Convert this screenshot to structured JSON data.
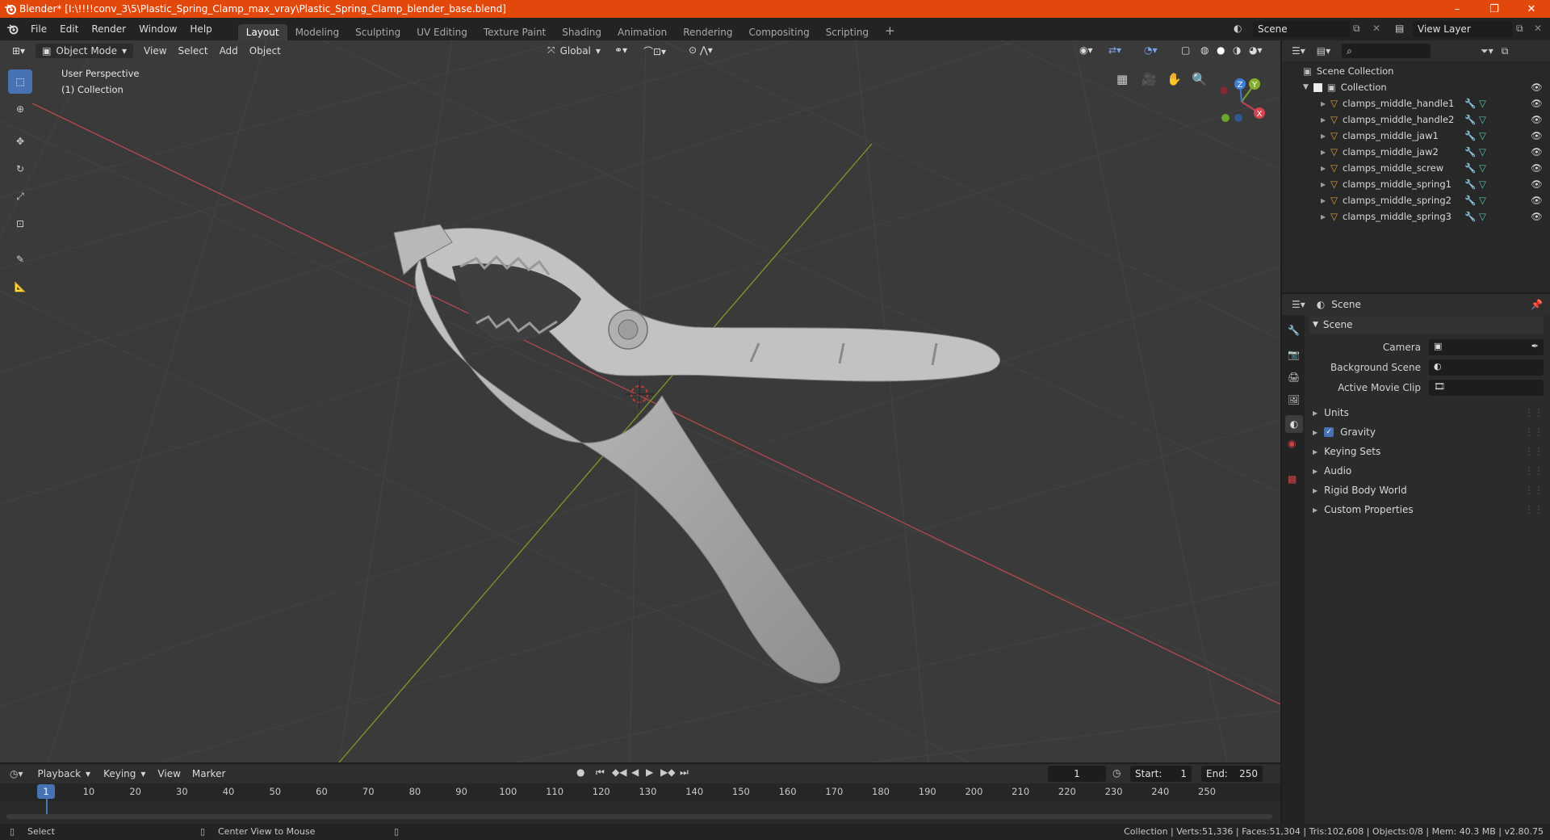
{
  "window": {
    "title": "Blender* [I:\\!!!!conv_3\\5\\Plastic_Spring_Clamp_max_vray\\Plastic_Spring_Clamp_blender_base.blend]",
    "controls": [
      "–",
      "❐",
      "✕"
    ]
  },
  "menu": [
    "File",
    "Edit",
    "Render",
    "Window",
    "Help"
  ],
  "workspaces": [
    {
      "label": "Layout",
      "active": true
    },
    {
      "label": "Modeling"
    },
    {
      "label": "Sculpting"
    },
    {
      "label": "UV Editing"
    },
    {
      "label": "Texture Paint"
    },
    {
      "label": "Shading"
    },
    {
      "label": "Animation"
    },
    {
      "label": "Rendering"
    },
    {
      "label": "Compositing"
    },
    {
      "label": "Scripting"
    }
  ],
  "add_workspace": "+",
  "scene_selector": {
    "value": "Scene"
  },
  "view_layer_selector": {
    "value": "View Layer"
  },
  "viewport": {
    "mode": "Object Mode",
    "menus": [
      "View",
      "Select",
      "Add",
      "Object"
    ],
    "transform_orientation": "Global",
    "overlay_text_line1": "User Perspective",
    "overlay_text_line2": "(1) Collection",
    "gizmo_axes": {
      "x": "X",
      "y": "Y",
      "z": "Z"
    },
    "colors": {
      "x_axis": "#b44a4f",
      "y_axis": "#7a9b2a",
      "background": "#3a3a3a",
      "grid": "#444444"
    }
  },
  "outliner": {
    "root": "Scene Collection",
    "collection": "Collection",
    "objects": [
      "clamps_middle_handle1",
      "clamps_middle_handle2",
      "clamps_middle_jaw1",
      "clamps_middle_jaw2",
      "clamps_middle_screw",
      "clamps_middle_spring1",
      "clamps_middle_spring2",
      "clamps_middle_spring3"
    ]
  },
  "properties": {
    "context": "Scene",
    "panel_title": "Scene",
    "fields": [
      {
        "label": "Camera",
        "value": ""
      },
      {
        "label": "Background Scene",
        "value": ""
      },
      {
        "label": "Active Movie Clip",
        "value": ""
      }
    ],
    "sections": [
      {
        "label": "Units"
      },
      {
        "label": "Gravity",
        "checkbox": true
      },
      {
        "label": "Keying Sets"
      },
      {
        "label": "Audio"
      },
      {
        "label": "Rigid Body World"
      },
      {
        "label": "Custom Properties"
      }
    ]
  },
  "timeline": {
    "menus": [
      "Playback",
      "Keying",
      "View",
      "Marker"
    ],
    "current_frame": "1",
    "start_label": "Start:",
    "start": "1",
    "end_label": "End:",
    "end": "250",
    "ruler_current": "1",
    "ruler": [
      "10",
      "20",
      "30",
      "40",
      "50",
      "60",
      "70",
      "80",
      "90",
      "100",
      "110",
      "120",
      "130",
      "140",
      "150",
      "160",
      "170",
      "180",
      "190",
      "200",
      "210",
      "220",
      "230",
      "240",
      "250"
    ]
  },
  "status": {
    "left_action": "Select",
    "middle_action": "Center View to Mouse",
    "stats": "Collection | Verts:51,336 | Faces:51,304 | Tris:102,608 | Objects:0/8 | Mem: 40.3 MB | v2.80.75"
  }
}
